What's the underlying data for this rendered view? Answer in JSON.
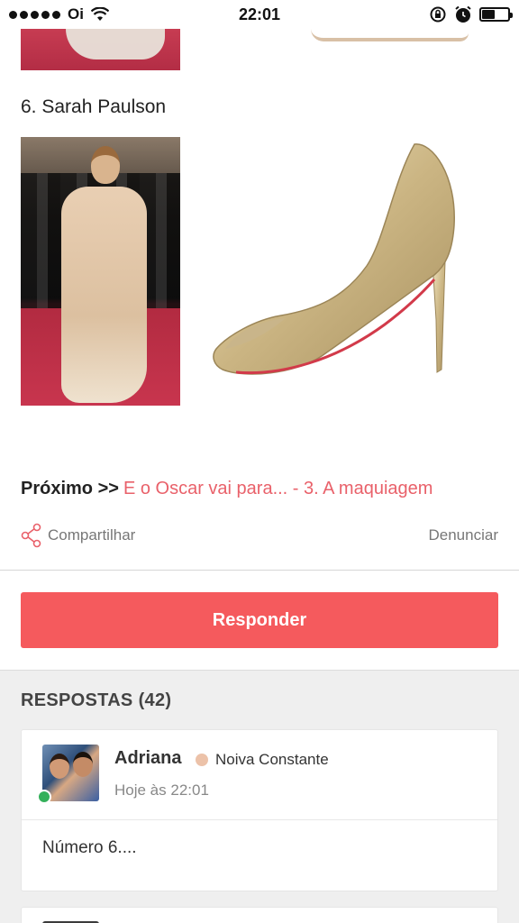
{
  "status_bar": {
    "carrier": "Oi",
    "time": "22:01",
    "battery_level": 0.5
  },
  "article": {
    "item_title": "6. Sarah Paulson"
  },
  "navigation": {
    "next_label": "Próximo >>",
    "next_link": "E o Oscar vai para... - 3. A maquiagem"
  },
  "actions": {
    "share_label": "Compartilhar",
    "report_label": "Denunciar",
    "reply_button": "Responder"
  },
  "responses": {
    "title": "RESPOSTAS",
    "count": "(42)",
    "items": [
      {
        "author": "Adriana",
        "rank": "Noiva Constante",
        "rank_color": "#ecc2a9",
        "online": true,
        "time": "Hoje às 22:01",
        "body": "Número 6...."
      }
    ]
  },
  "colors": {
    "accent": "#f55a5d",
    "link": "#e9616a",
    "online": "#33b05a"
  }
}
